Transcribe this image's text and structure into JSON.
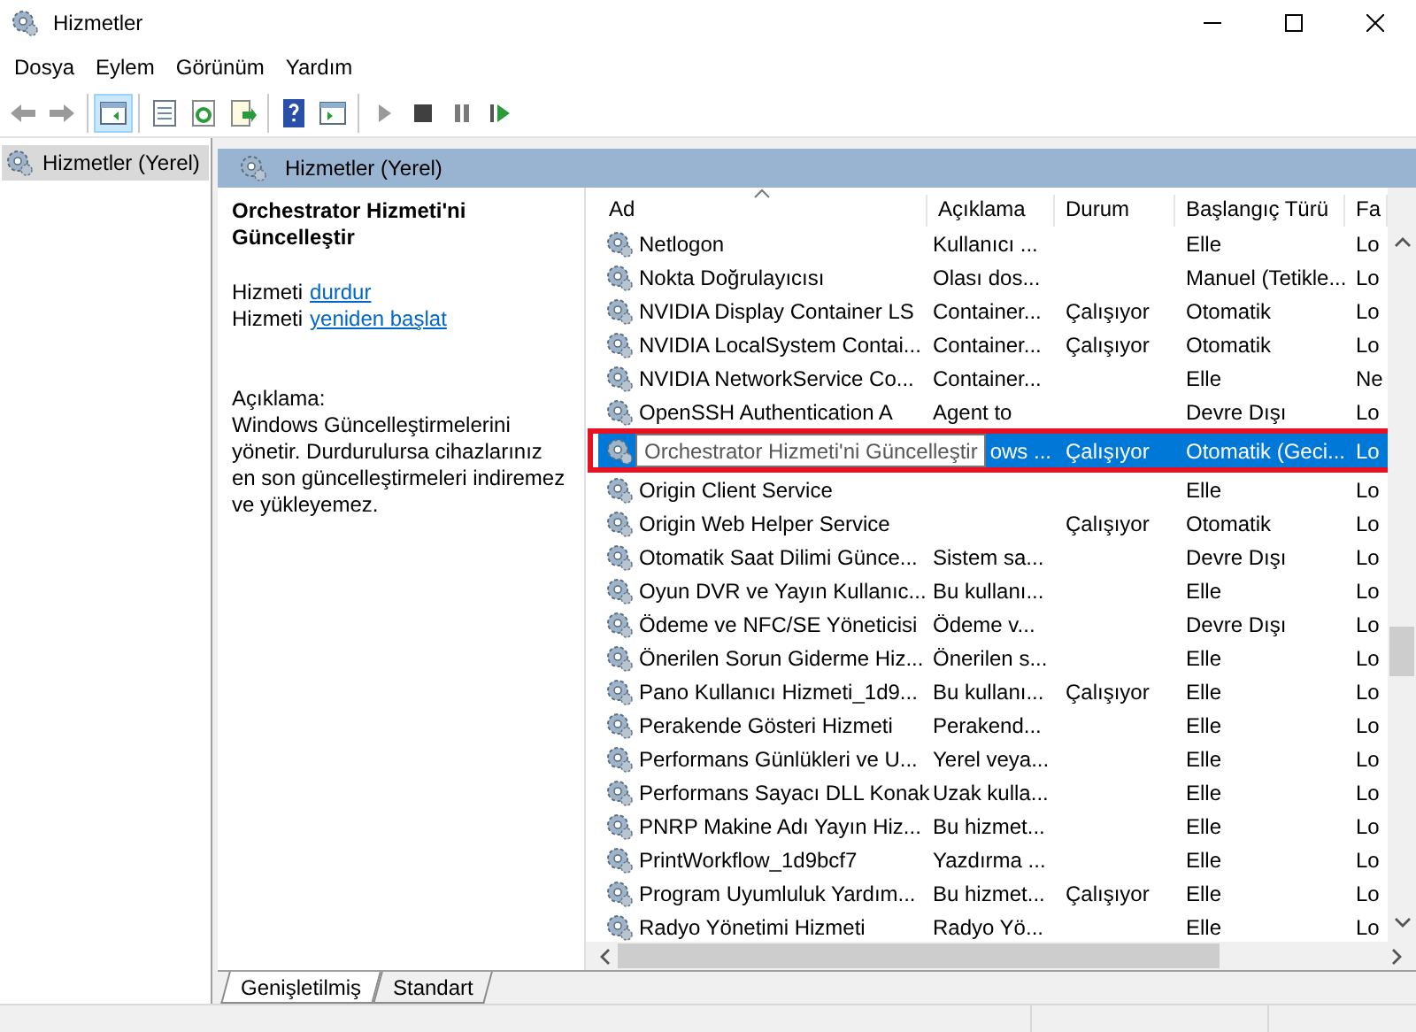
{
  "window": {
    "title": "Hizmetler"
  },
  "menu": [
    "Dosya",
    "Eylem",
    "Görünüm",
    "Yardım"
  ],
  "tree": [
    {
      "label": "Hizmetler (Yerel)",
      "selected": true
    }
  ],
  "panel": {
    "title": "Hizmetler (Yerel)"
  },
  "details": {
    "title": "Orchestrator Hizmeti'ni Güncelleştir",
    "actions": [
      {
        "prefix": "Hizmeti",
        "link": "durdur"
      },
      {
        "prefix": "Hizmeti",
        "link": "yeniden başlat"
      }
    ],
    "description_label": "Açıklama:",
    "description": "Windows Güncelleştirmelerini yönetir. Durdurulursa cihazlarınız en son güncelleştirmeleri indiremez ve yükleyemez."
  },
  "table": {
    "columns": [
      "Ad",
      "Açıklama",
      "Durum",
      "Başlangıç Türü",
      "Fa"
    ],
    "rows": [
      {
        "name": "Netlogon",
        "description": "Kullanıcı ...",
        "startup": "Elle",
        "column_5": "Lo",
        "selected": false
      },
      {
        "name": "Nokta Doğrulayıcısı",
        "description": "Olası dos...",
        "startup": "Manuel (Tetikle...",
        "column_5": "Lo",
        "selected": false
      },
      {
        "name": "NVIDIA Display Container LS",
        "description": "Container...",
        "status": "Çalışıyor",
        "startup": "Otomatik",
        "column_5": "Lo",
        "selected": false
      },
      {
        "name": "NVIDIA LocalSystem Contai...",
        "description": "Container...",
        "status": "Çalışıyor",
        "startup": "Otomatik",
        "column_5": "Lo",
        "selected": false
      },
      {
        "name": "NVIDIA NetworkService Co...",
        "description": "Container...",
        "startup": "Elle",
        "column_5": "Ne",
        "selected": false
      },
      {
        "name": "OpenSSH Authentication A",
        "description": "Agent to",
        "startup": "Devre Dışı",
        "column_5": "Lo",
        "selected": false
      },
      {
        "description": "ows ...",
        "status": "Çalışıyor",
        "startup": "Otomatik (Geci...",
        "column_5": "Lo",
        "selected": true
      },
      {
        "name": "Origin Client Service",
        "startup": "Elle",
        "column_5": "Lo",
        "selected": false
      },
      {
        "name": "Origin Web Helper Service",
        "status": "Çalışıyor",
        "startup": "Otomatik",
        "column_5": "Lo",
        "selected": false
      },
      {
        "name": "Otomatik Saat Dilimi Günce...",
        "description": "Sistem sa...",
        "startup": "Devre Dışı",
        "column_5": "Lo",
        "selected": false
      },
      {
        "name": "Oyun DVR ve Yayın Kullanıc...",
        "description": "Bu kullanı...",
        "startup": "Elle",
        "column_5": "Lo",
        "selected": false
      },
      {
        "name": "Ödeme ve NFC/SE Yöneticisi",
        "description": "Ödeme v...",
        "startup": "Devre Dışı",
        "column_5": "Lo",
        "selected": false
      },
      {
        "name": "Önerilen Sorun Giderme Hiz...",
        "description": "Önerilen s...",
        "startup": "Elle",
        "column_5": "Lo",
        "selected": false
      },
      {
        "name": "Pano Kullanıcı Hizmeti_1d9...",
        "description": "Bu kullanı...",
        "status": "Çalışıyor",
        "startup": "Elle",
        "column_5": "Lo",
        "selected": false
      },
      {
        "name": "Perakende Gösteri Hizmeti",
        "description": "Perakend...",
        "startup": "Elle",
        "column_5": "Lo",
        "selected": false
      },
      {
        "name": "Performans Günlükleri ve U...",
        "description": "Yerel veya...",
        "startup": "Elle",
        "column_5": "Lo",
        "selected": false
      },
      {
        "name": "Performans Sayacı DLL Konak",
        "description": "Uzak kulla...",
        "startup": "Elle",
        "column_5": "Lo",
        "selected": false
      },
      {
        "name": "PNRP Makine Adı Yayın Hiz...",
        "description": "Bu hizmet...",
        "startup": "Elle",
        "column_5": "Lo",
        "selected": false
      },
      {
        "name": "PrintWorkflow_1d9bcf7",
        "description": "Yazdırma ...",
        "startup": "Elle",
        "column_5": "Lo",
        "selected": false
      },
      {
        "name": "Program Uyumluluk Yardım...",
        "description": "Bu hizmet...",
        "status": "Çalışıyor",
        "startup": "Elle",
        "column_5": "Lo",
        "selected": false
      },
      {
        "name": "Radyo Yönetimi Hizmeti",
        "description": "Radyo Yö...",
        "startup": "Elle",
        "column_5": "Lo",
        "selected": false
      }
    ]
  },
  "tooltip": {
    "text": "Orchestrator Hizmeti'ni Güncelleştir"
  },
  "tabs": [
    {
      "label": "Genişletilmiş",
      "selected": true
    },
    {
      "label": "Standart",
      "selected": false
    }
  ]
}
